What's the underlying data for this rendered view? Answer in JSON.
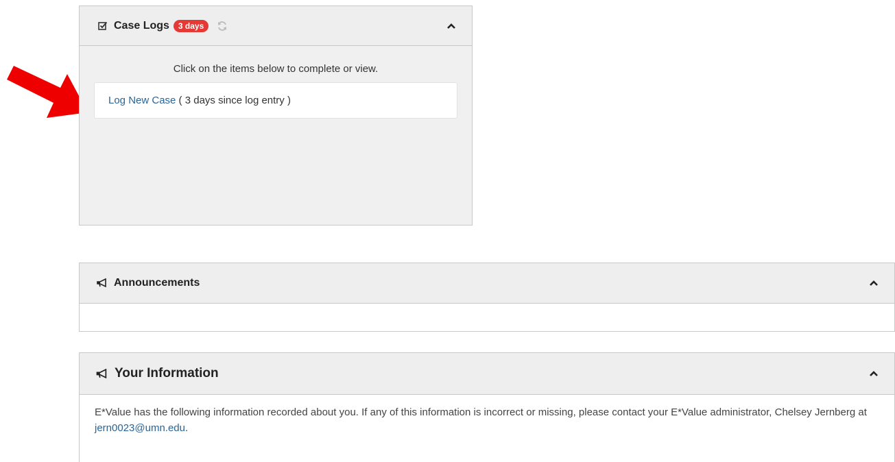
{
  "case_logs": {
    "title": "Case Logs",
    "badge": "3 days",
    "instructions": "Click on the items below to complete or view.",
    "item_link": "Log New Case",
    "item_suffix": " ( 3 days since log entry )"
  },
  "announcements": {
    "title": "Announcements"
  },
  "your_info": {
    "title": "Your Information",
    "text_1": "E*Value has the following information recorded about you. If any of this information is incorrect or missing, please contact your E*Value administrator, Chelsey Jernberg at ",
    "email": "jern0023@umn.edu",
    "text_2": "."
  },
  "colors": {
    "badge": "#e53935",
    "link": "#2a6496",
    "arrow": "#ee0000",
    "header_bg": "#eeeeee"
  },
  "icons": [
    "checkbox-icon",
    "refresh-icon",
    "chevron-up-icon",
    "bullhorn-icon",
    "red-arrow"
  ]
}
